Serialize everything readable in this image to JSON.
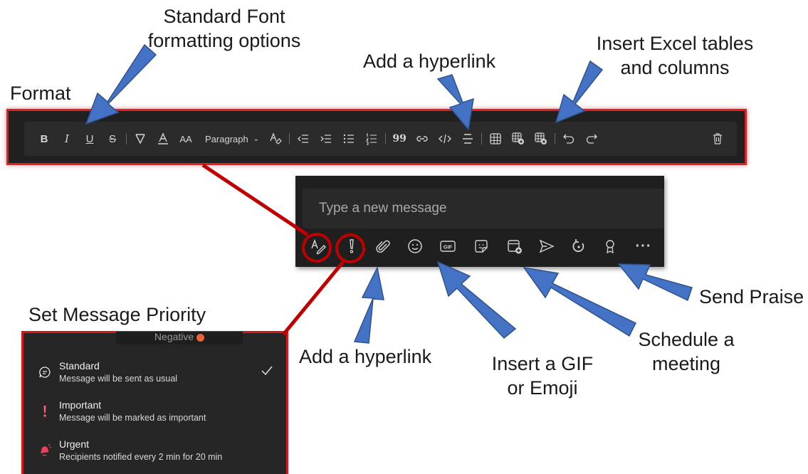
{
  "annotations": {
    "standard_font_line1": "Standard Font",
    "standard_font_line2": "formatting options",
    "format": "Format",
    "add_hyperlink_top": "Add a hyperlink",
    "insert_excel_line1": "Insert Excel tables",
    "insert_excel_line2": "and columns",
    "set_priority": "Set Message Priority",
    "add_hyperlink_bottom": "Add a hyperlink",
    "insert_gif_line1": "Insert a GIF",
    "insert_gif_line2": "or Emoji",
    "schedule_line1": "Schedule a",
    "schedule_line2": "meeting",
    "send_praise": "Send Praise"
  },
  "toolbar": {
    "bold_glyph": "B",
    "italic_glyph": "I",
    "underline_glyph": "U",
    "strike_glyph": "S",
    "font_color_glyph": "A",
    "font_size_glyph": "AA",
    "paragraph_label": "Paragraph",
    "clear_format_glyph": "A",
    "quote_glyph": "99"
  },
  "compose": {
    "placeholder": "Type a new message",
    "more_glyph": "···"
  },
  "priority": {
    "header_partial": "Negative",
    "options": [
      {
        "title": "Standard",
        "desc": "Message will be sent as usual",
        "selected": true
      },
      {
        "title": "Important",
        "desc": "Message will be marked as important",
        "selected": false
      },
      {
        "title": "Urgent",
        "desc": "Recipients notified every 2 min for 20 min",
        "selected": false
      }
    ]
  },
  "colors": {
    "arrow_blue": "#4472c4",
    "highlight_red": "#c00000",
    "important_red": "#ff5c7a",
    "urgent_red": "#e8435a"
  }
}
